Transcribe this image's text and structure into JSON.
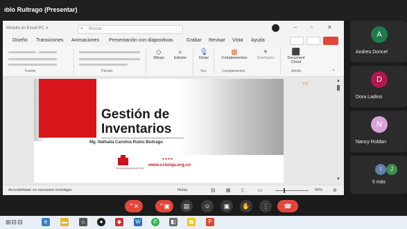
{
  "window": {
    "title": "ıblo Ruitrago (Presentar)"
  },
  "ppt": {
    "file_title": "Modulo en Excel-PC  ∨",
    "search_placeholder": "Buscar",
    "menu": [
      "Diseño",
      "Transiciones",
      "Animaciones",
      "Presentación con diapositivas",
      "Grabar",
      "Revisar",
      "Vista",
      "Ayuda"
    ],
    "ribbon": {
      "groups": [
        "Fuente",
        "Párrafo",
        "Voz",
        "Complementos",
        "Adobe"
      ],
      "buttons": [
        "Dibujo",
        "Edición",
        "Dictar",
        "Complementos",
        "Diseñador",
        "Document Cloud"
      ]
    },
    "slide": {
      "title_line1": "Gestión de",
      "title_line2": "Inventarios",
      "author": "Mg. Nathalia Carolina Rubio Buitrago",
      "logo_caption": "Tienda de Desarrollo de Tunja",
      "logo_url": "www.cctunja.org.co",
      "logo_dots": "●●●●"
    },
    "status": {
      "accessibility": "Accesibilidad: es necesario investigar",
      "notes": "Notas",
      "zoom": "56%"
    }
  },
  "participants": [
    {
      "initial": "A",
      "name": "Andres Doncel",
      "color": "#1f7a4d"
    },
    {
      "initial": "D",
      "name": "Dora Ladino",
      "color": "#b0174f"
    },
    {
      "initial": "N",
      "name": "Nancy Roldan",
      "color": "#d9a4d8"
    }
  ],
  "more": {
    "initials": [
      "I",
      "J"
    ],
    "label": "5 más"
  },
  "colors": {
    "accent_red": "#d8151b",
    "end_call": "#e4453a"
  }
}
